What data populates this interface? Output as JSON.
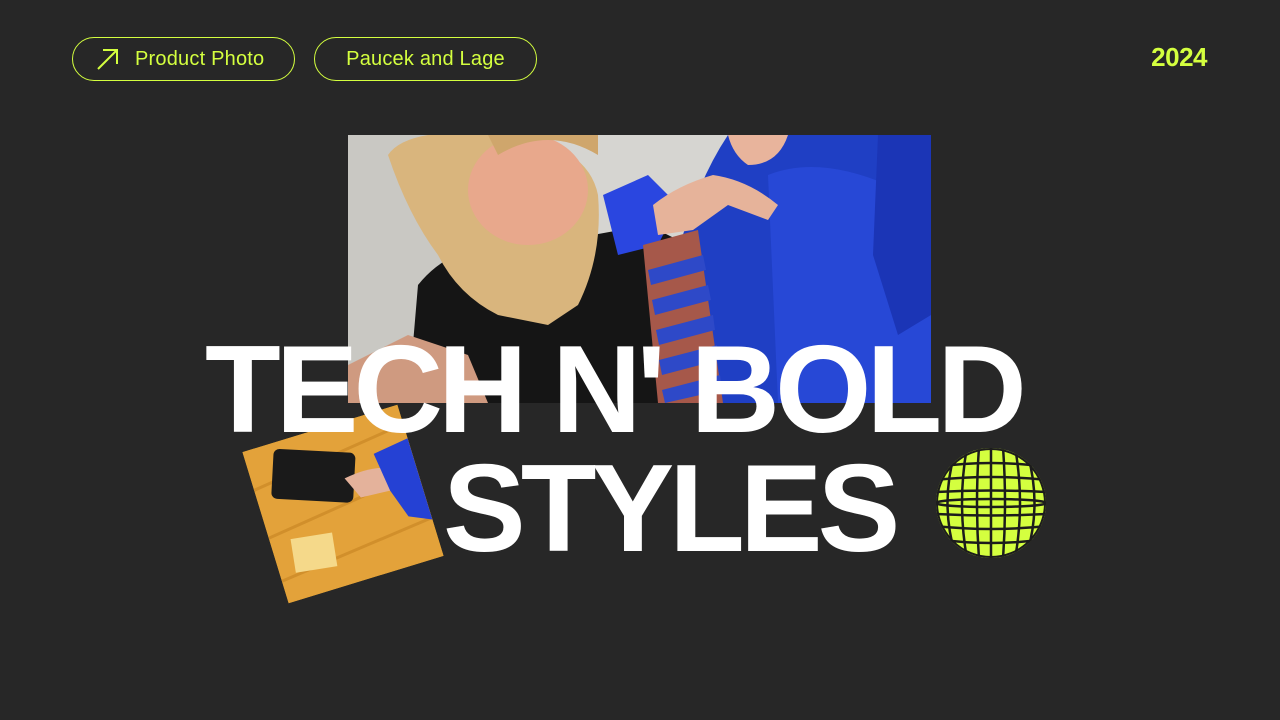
{
  "tags": {
    "category_label": "Product Photo",
    "brand_label": "Paucek and Lage"
  },
  "year": "2024",
  "title": {
    "line1": "TECH N' BOLD",
    "line2": "STYLES"
  },
  "icons": {
    "pill_icon": "arrow-up-right-icon",
    "globe_icon": "disco-ball-icon"
  },
  "colors": {
    "background": "#272727",
    "accent": "#d4ff3f",
    "title": "#ffffff"
  }
}
